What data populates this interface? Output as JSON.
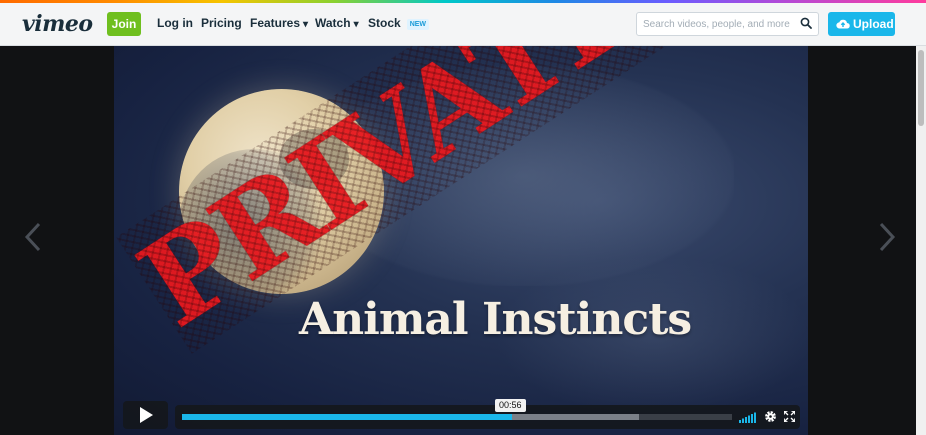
{
  "header": {
    "logo": "vimeo",
    "join_label": "Join",
    "nav": {
      "login": "Log in",
      "pricing": "Pricing",
      "features": "Features",
      "watch": "Watch",
      "stock": "Stock",
      "stock_badge": "NEW"
    },
    "search_placeholder": "Search videos, people, and more",
    "upload_label": "Upload"
  },
  "player": {
    "stamp_text": "PRIVATE",
    "poster_title": "Animal Instincts",
    "current_time": "00:56",
    "progress_played": 0.6,
    "progress_buffered": 0.83
  },
  "colors": {
    "accent": "#1ab7ea",
    "join": "#6fbf1f",
    "stamp": "#e8191f"
  }
}
